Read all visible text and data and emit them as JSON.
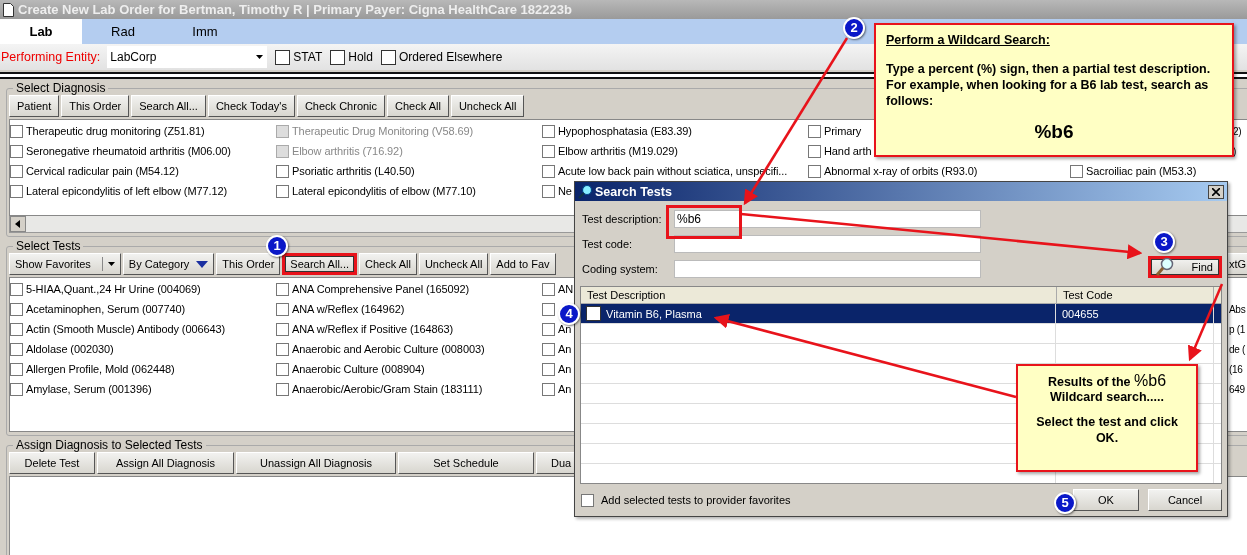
{
  "window": {
    "title": "Create New Lab Order for Bertman, Timothy R | Primary Payer: Cigna HealthCare 182223b"
  },
  "tabs": [
    {
      "label": "Lab",
      "selected": true
    },
    {
      "label": "Rad",
      "selected": false
    },
    {
      "label": "Imm",
      "selected": false
    }
  ],
  "order_options": {
    "entity_label": "Performing Entity:",
    "entity_value": "LabCorp",
    "flags": [
      {
        "label": "STAT",
        "checked": false
      },
      {
        "label": "Hold",
        "checked": false
      },
      {
        "label": "Ordered Elsewhere",
        "checked": false
      }
    ]
  },
  "diagnosis": {
    "title": "Select Diagnosis",
    "buttons": [
      "Patient",
      "This Order",
      "Search All...",
      "Check Today's",
      "Check Chronic",
      "Check All",
      "Uncheck All"
    ],
    "rows": [
      {
        "cells": [
          {
            "label": "Therapeutic drug monitoring (Z51.81)",
            "checked": false,
            "disabled": false
          },
          {
            "label": "Therapeutic Drug Monitoring (V58.69)",
            "checked": false,
            "disabled": true
          },
          {
            "label": "Hypophosphatasia (E83.39)",
            "checked": false,
            "disabled": false
          },
          {
            "label": "Primary",
            "checked": false,
            "disabled": false
          }
        ],
        "edge_text": "2)"
      },
      {
        "cells": [
          {
            "label": "Seronegative rheumatoid arthritis (M06.00)",
            "checked": false,
            "disabled": false
          },
          {
            "label": "Elbow arthritis (716.92)",
            "checked": false,
            "disabled": true
          },
          {
            "label": "Elbow arthritis (M19.029)",
            "checked": false,
            "disabled": false
          },
          {
            "label": "Hand arth",
            "checked": false,
            "disabled": false
          }
        ],
        "edge_text": ")"
      },
      {
        "cells": [
          {
            "label": "Cervical radicular pain (M54.12)",
            "checked": false,
            "disabled": false
          },
          {
            "label": "Psoriatic arthritis (L40.50)",
            "checked": false,
            "disabled": false
          },
          {
            "label": "Acute low back pain without sciatica, unspecifi...",
            "checked": false,
            "disabled": false
          },
          {
            "label": "Abnormal x-ray of orbits (R93.0)",
            "checked": false,
            "disabled": false
          },
          {
            "label": "Sacroiliac pain (M53.3)",
            "checked": false,
            "disabled": false
          }
        ]
      },
      {
        "cells": [
          {
            "label": "Lateral epicondylitis of left elbow (M77.12)",
            "checked": false,
            "disabled": false
          },
          {
            "label": "Lateral epicondylitis  of elbow (M77.10)",
            "checked": false,
            "disabled": false
          },
          {
            "label": "Ne",
            "checked": false,
            "disabled": false
          }
        ]
      }
    ]
  },
  "tests": {
    "title": "Select Tests",
    "buttons": [
      {
        "label": "Show Favorites",
        "kind": "split",
        "highlighted": false
      },
      {
        "label": "By Category",
        "kind": "dropdown",
        "highlighted": false
      },
      {
        "label": "This Order",
        "kind": "plain",
        "highlighted": false
      },
      {
        "label": "Search All...",
        "kind": "plain",
        "highlighted": true
      },
      {
        "label": "Check All",
        "kind": "plain",
        "highlighted": false
      },
      {
        "label": "Uncheck All",
        "kind": "plain",
        "highlighted": false
      },
      {
        "label": "Add to Fav",
        "kind": "plain",
        "highlighted": false
      }
    ],
    "edge_button": "xtG",
    "rows": [
      {
        "cells": [
          {
            "label": "5-HIAA,Quant.,24 Hr Urine (004069)",
            "checked": false
          },
          {
            "label": "ANA Comprehensive Panel (165092)",
            "checked": false
          },
          {
            "label": "AN",
            "checked": false
          }
        ]
      },
      {
        "cells": [
          {
            "label": "Acetaminophen, Serum (007740)",
            "checked": false
          },
          {
            "label": "ANA w/Reflex (164962)",
            "checked": false
          },
          {
            "checked": false
          }
        ],
        "edge_text": "Abs"
      },
      {
        "cells": [
          {
            "label": "Actin (Smooth Muscle) Antibody (006643)",
            "checked": false
          },
          {
            "label": "ANA w/Reflex if Positive (164863)",
            "checked": false
          },
          {
            "label": "An",
            "checked": false
          }
        ],
        "edge_text": "p (1"
      },
      {
        "cells": [
          {
            "label": "Aldolase (002030)",
            "checked": false
          },
          {
            "label": "Anaerobic and Aerobic Culture (008003)",
            "checked": false
          },
          {
            "label": "An",
            "checked": false
          }
        ],
        "edge_text": "de ("
      },
      {
        "cells": [
          {
            "label": "Allergen Profile, Mold (062448)",
            "checked": false
          },
          {
            "label": "Anaerobic Culture (008904)",
            "checked": false
          },
          {
            "label": "An",
            "checked": false
          }
        ],
        "edge_text": "(16"
      },
      {
        "cells": [
          {
            "label": "Amylase, Serum (001396)",
            "checked": false
          },
          {
            "label": "Anaerobic/Aerobic/Gram Stain (183111)",
            "checked": false
          },
          {
            "label": "An",
            "checked": false
          }
        ],
        "edge_text": "649"
      }
    ]
  },
  "assign": {
    "title": "Assign Diagnosis to Selected Tests",
    "buttons": [
      "Delete Test",
      "Assign All Diagnosis",
      "Unassign All Diagnosis",
      "Set Schedule",
      "Dua"
    ]
  },
  "dialog": {
    "title": "Search Tests",
    "fields": [
      {
        "label": "Test description:",
        "value": "%b6"
      },
      {
        "label": "Test code:"
      },
      {
        "label": "Coding system:"
      }
    ],
    "find_label": "Find",
    "find_highlighted": true,
    "columns": [
      "Test Description",
      "Test Code"
    ],
    "results": [
      {
        "description": "Vitamin B6, Plasma",
        "code": "004655",
        "selected": true,
        "checked": false
      }
    ],
    "favorites": {
      "label": "Add selected tests to provider favorites",
      "checked": false
    },
    "buttons": [
      "OK",
      "Cancel"
    ]
  },
  "tip_callout": {
    "heading": "Perform a Wildcard Search:",
    "text": "Type a percent (%) sign, then a partial test description.  For example, when looking for a B6 lab test, search as follows:",
    "example": "%b6"
  },
  "result_callout": {
    "before": "Results of the",
    "term": "%b6",
    "after": "Wildcard search.....",
    "instruction": "Select the test and click OK."
  },
  "steps": [
    "1",
    "2",
    "3",
    "4",
    "5"
  ]
}
